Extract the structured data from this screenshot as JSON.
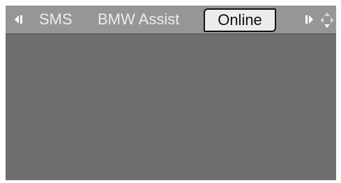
{
  "tabs": {
    "sms": "SMS",
    "assist": "BMW Assist",
    "online": "Online"
  },
  "icons": {
    "left": "arrow-left-icon",
    "right": "arrow-right-icon",
    "controller": "controller-icon"
  },
  "colors": {
    "background": "#6e6e6e",
    "topbar": "#969696",
    "selected_tab": "#ececec"
  }
}
